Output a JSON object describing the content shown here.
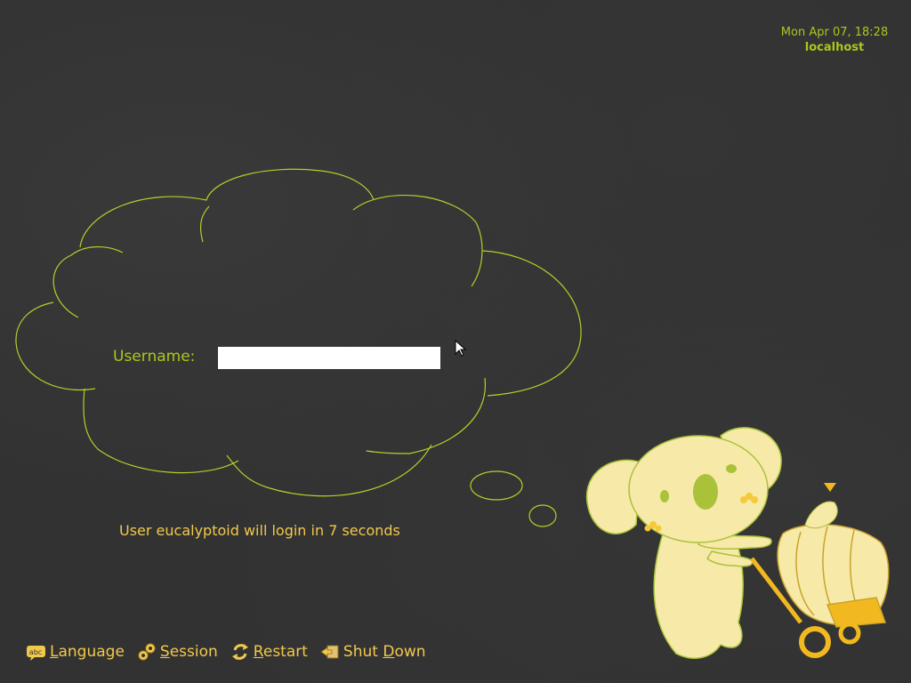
{
  "clock": {
    "datetime": "Mon Apr 07, 18:28",
    "hostname": "localhost"
  },
  "login": {
    "username_label": "Username:",
    "username_value": "",
    "autologin_message": "User eucalyptoid will login in 7 seconds"
  },
  "toolbar": {
    "language": {
      "accel": "L",
      "rest": "anguage",
      "icon": "language-icon"
    },
    "session": {
      "accel": "S",
      "rest": "ession",
      "icon": "session-gears-icon"
    },
    "restart": {
      "accel": "R",
      "rest": "estart",
      "icon": "restart-icon"
    },
    "shutdown": {
      "pre": "Shut ",
      "accel": "D",
      "rest": "own",
      "icon": "shutdown-icon"
    }
  },
  "colors": {
    "background": "#323232",
    "green_accent": "#a8c81e",
    "yellow_text": "#f2c84b",
    "koala_fill": "#f7e9a8"
  }
}
